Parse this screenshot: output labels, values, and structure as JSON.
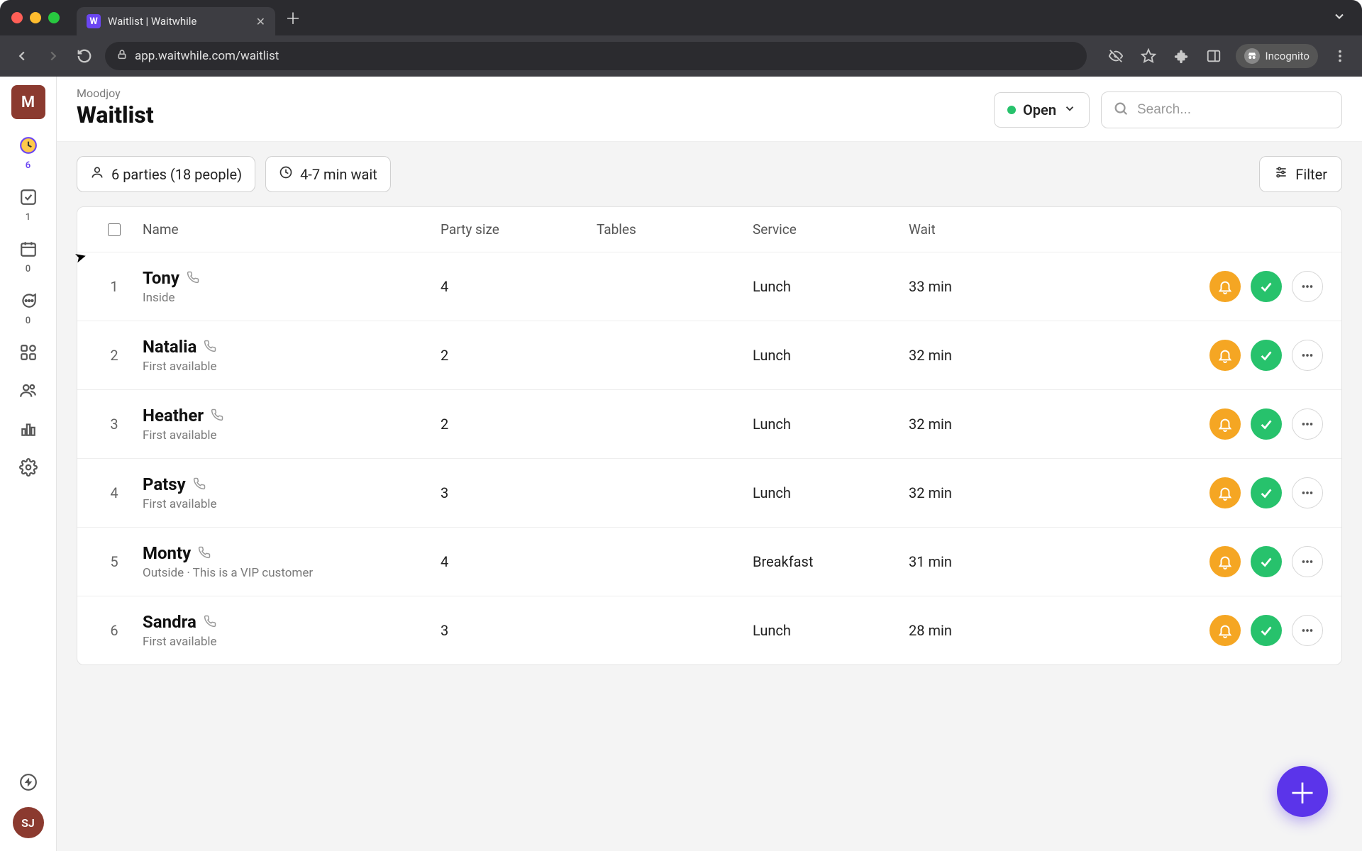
{
  "browser": {
    "tab_title": "Waitlist | Waitwhile",
    "tab_favicon_letter": "W",
    "url": "app.waitwhile.com/waitlist",
    "incognito_label": "Incognito"
  },
  "sidebar": {
    "logo": "M",
    "items": [
      {
        "id": "waitlist",
        "icon": "clock",
        "badge": "6",
        "active": true
      },
      {
        "id": "done",
        "icon": "check-sq",
        "badge": "1",
        "active": false
      },
      {
        "id": "calendar",
        "icon": "calendar",
        "badge": "0",
        "active": false
      },
      {
        "id": "messages",
        "icon": "chat",
        "badge": "0",
        "active": false
      },
      {
        "id": "apps",
        "icon": "grid",
        "badge": "",
        "active": false
      },
      {
        "id": "people",
        "icon": "people",
        "badge": "",
        "active": false
      },
      {
        "id": "stats",
        "icon": "bars",
        "badge": "",
        "active": false
      },
      {
        "id": "settings",
        "icon": "gear",
        "badge": "",
        "active": false
      }
    ],
    "bottom": {
      "zap_icon": true,
      "avatar": "SJ"
    }
  },
  "header": {
    "breadcrumb": "Moodjoy",
    "page_title": "Waitlist",
    "open_label": "Open",
    "search_placeholder": "Search..."
  },
  "summary": {
    "parties_label": "6 parties (18 people)",
    "wait_label": "4-7 min wait",
    "filter_label": "Filter"
  },
  "table": {
    "columns": {
      "name": "Name",
      "party": "Party size",
      "tables": "Tables",
      "service": "Service",
      "wait": "Wait"
    },
    "rows": [
      {
        "n": "1",
        "name": "Tony",
        "sub": "Inside",
        "party": "4",
        "tables": "",
        "service": "Lunch",
        "wait": "33 min"
      },
      {
        "n": "2",
        "name": "Natalia",
        "sub": "First available",
        "party": "2",
        "tables": "",
        "service": "Lunch",
        "wait": "32 min"
      },
      {
        "n": "3",
        "name": "Heather",
        "sub": "First available",
        "party": "2",
        "tables": "",
        "service": "Lunch",
        "wait": "32 min"
      },
      {
        "n": "4",
        "name": "Patsy",
        "sub": "First available",
        "party": "3",
        "tables": "",
        "service": "Lunch",
        "wait": "32 min"
      },
      {
        "n": "5",
        "name": "Monty",
        "sub": "Outside  ·  This is a VIP customer",
        "party": "4",
        "tables": "",
        "service": "Breakfast",
        "wait": "31 min"
      },
      {
        "n": "6",
        "name": "Sandra",
        "sub": "First available",
        "party": "3",
        "tables": "",
        "service": "Lunch",
        "wait": "28 min"
      }
    ]
  }
}
